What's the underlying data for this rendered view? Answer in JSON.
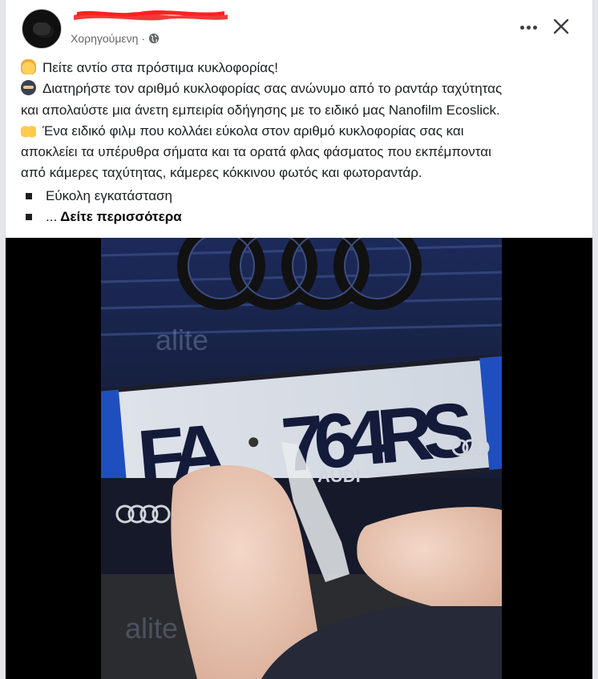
{
  "post": {
    "sponsored_label": "Χορηγούμενη",
    "separator": "·",
    "icons": {
      "privacy": "globe-icon",
      "more": "more-horizontal-icon",
      "close": "close-icon"
    },
    "lines": [
      {
        "emoji": "raised-hand-emoji",
        "text": "Πείτε αντίο στα πρόστιμα κυκλοφορίας!"
      },
      {
        "emoji": "ninja-emoji",
        "text": "Διατηρήστε τον αριθμό κυκλοφορίας σας ανώνυμο από το ραντάρ ταχύτητας"
      },
      {
        "emoji": "",
        "text": "και απολαύστε μια άνετη εμπειρία οδήγησης με το ειδικό μας Nanofilm Ecoslick."
      },
      {
        "emoji": "raising-hands-emoji",
        "text": "Ένα ειδικό φιλμ που κολλάει εύκολα στον αριθμό κυκλοφορίας σας και"
      },
      {
        "emoji": "",
        "text": "αποκλείει τα υπέρυθρα σήματα και τα ορατά φλας φάσματος που εκπέμπονται"
      },
      {
        "emoji": "",
        "text": "από κάμερες ταχύτητας, κάμερες κόκκινου φωτός και φωτοραντάρ."
      }
    ],
    "bullets": [
      "Εύκολη εγκατάσταση"
    ],
    "ellipsis": "...",
    "see_more": "Δείτε περισσότερα"
  },
  "media": {
    "plate_prefix": "FA",
    "plate_number": "764RS",
    "brand_text": "AUDI",
    "watermark": "alite"
  }
}
